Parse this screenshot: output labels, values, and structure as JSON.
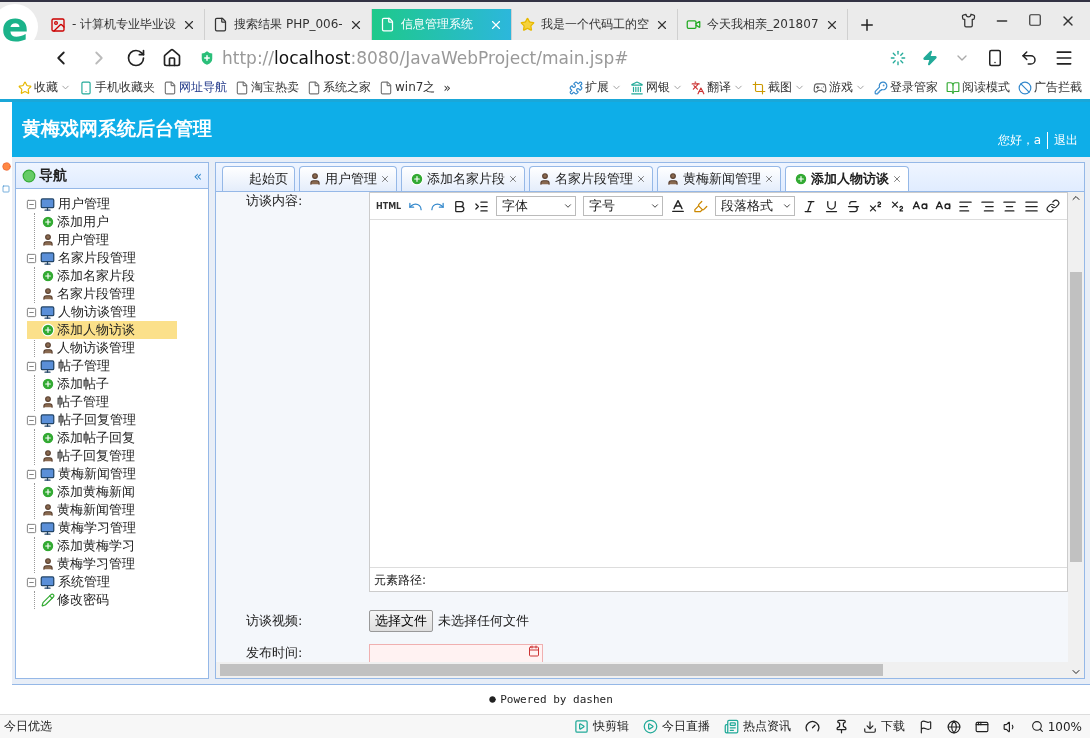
{
  "browser": {
    "logo": "e",
    "tabs": [
      {
        "title": "- 计算机专业毕业设",
        "kind": "image",
        "selected": false
      },
      {
        "title": "搜索结果 PHP_006-",
        "kind": "page",
        "selected": false
      },
      {
        "title": "信息管理系统",
        "kind": "page",
        "selected": true
      },
      {
        "title": "我是一个代码工的空",
        "kind": "star",
        "selected": false
      },
      {
        "title": "今天我相亲_201807",
        "kind": "video",
        "selected": false
      }
    ],
    "url": {
      "scheme": "http://",
      "host": "localhost",
      "path": ":8080/JavaWebProject/main.jsp#"
    },
    "bookmarks_left": [
      {
        "label": "收藏",
        "kind": "star",
        "menu": true
      },
      {
        "label": "手机收藏夹",
        "kind": "phone",
        "menu": false
      },
      {
        "label": "网址导航",
        "kind": "page",
        "menu": false
      },
      {
        "label": "淘宝热卖",
        "kind": "page",
        "menu": false
      },
      {
        "label": "系统之家",
        "kind": "page",
        "menu": false
      },
      {
        "label": "win7之",
        "kind": "page",
        "menu": false
      }
    ],
    "bookmarks_more": "»",
    "bookmarks_right": [
      {
        "label": "扩展",
        "kind": "apps",
        "menu": true
      },
      {
        "label": "网银",
        "kind": "bank",
        "menu": true
      },
      {
        "label": "翻译",
        "kind": "translate",
        "menu": true
      },
      {
        "label": "截图",
        "kind": "crop",
        "menu": true
      },
      {
        "label": "游戏",
        "kind": "game",
        "menu": true
      },
      {
        "label": "登录管家",
        "kind": "key",
        "menu": false
      },
      {
        "label": "阅读模式",
        "kind": "book",
        "menu": false
      },
      {
        "label": "广告拦截",
        "kind": "block",
        "menu": false
      }
    ]
  },
  "header": {
    "title": "黄梅戏网系统后台管理",
    "greeting": "您好，a",
    "logout": "退出"
  },
  "sidebar": {
    "title": "导航",
    "collapse": "«",
    "items": [
      {
        "label": "用户管理",
        "expanded": true,
        "children": [
          {
            "label": "添加用户",
            "kind": "add",
            "selected": false
          },
          {
            "label": "用户管理",
            "kind": "manage",
            "selected": false
          }
        ]
      },
      {
        "label": "名家片段管理",
        "expanded": true,
        "children": [
          {
            "label": "添加名家片段",
            "kind": "add",
            "selected": false
          },
          {
            "label": "名家片段管理",
            "kind": "manage",
            "selected": false
          }
        ]
      },
      {
        "label": "人物访谈管理",
        "expanded": true,
        "children": [
          {
            "label": "添加人物访谈",
            "kind": "add",
            "selected": true
          },
          {
            "label": "人物访谈管理",
            "kind": "manage",
            "selected": false
          }
        ]
      },
      {
        "label": "帖子管理",
        "expanded": true,
        "children": [
          {
            "label": "添加帖子",
            "kind": "add",
            "selected": false
          },
          {
            "label": "帖子管理",
            "kind": "manage",
            "selected": false
          }
        ]
      },
      {
        "label": "帖子回复管理",
        "expanded": true,
        "children": [
          {
            "label": "添加帖子回复",
            "kind": "add",
            "selected": false
          },
          {
            "label": "帖子回复管理",
            "kind": "manage",
            "selected": false
          }
        ]
      },
      {
        "label": "黄梅新闻管理",
        "expanded": true,
        "children": [
          {
            "label": "添加黄梅新闻",
            "kind": "add",
            "selected": false
          },
          {
            "label": "黄梅新闻管理",
            "kind": "manage",
            "selected": false
          }
        ]
      },
      {
        "label": "黄梅学习管理",
        "expanded": true,
        "children": [
          {
            "label": "添加黄梅学习",
            "kind": "add",
            "selected": false
          },
          {
            "label": "黄梅学习管理",
            "kind": "manage",
            "selected": false
          }
        ]
      },
      {
        "label": "系统管理",
        "expanded": true,
        "children": [
          {
            "label": "修改密码",
            "kind": "edit",
            "selected": false
          }
        ]
      }
    ]
  },
  "tabs": [
    {
      "label": "起始页",
      "kind": "home",
      "closable": false,
      "selected": false
    },
    {
      "label": "用户管理",
      "kind": "manage",
      "closable": true,
      "selected": false
    },
    {
      "label": "添加名家片段",
      "kind": "add",
      "closable": true,
      "selected": false
    },
    {
      "label": "名家片段管理",
      "kind": "manage",
      "closable": true,
      "selected": false
    },
    {
      "label": "黄梅新闻管理",
      "kind": "manage",
      "closable": true,
      "selected": false
    },
    {
      "label": "添加人物访谈",
      "kind": "add",
      "closable": true,
      "selected": true
    }
  ],
  "form": {
    "content_label": "访谈内容:",
    "editor": {
      "html_label": "HTML",
      "font": "字体",
      "size": "字号",
      "paragraph": "段落格式",
      "path_label": "元素路径:"
    },
    "video_label": "访谈视频:",
    "file_button": "选择文件",
    "file_status": "未选择任何文件",
    "date_label": "发布时间:"
  },
  "footer": "Powered by dashen",
  "status_bar": {
    "left": "今日优选",
    "items": [
      {
        "label": "快剪辑",
        "kind": "clip"
      },
      {
        "label": "今日直播",
        "kind": "live"
      },
      {
        "label": "热点资讯",
        "kind": "news"
      },
      {
        "label": "下载",
        "kind": "download"
      },
      {
        "label": "100%",
        "kind": "zoom"
      }
    ]
  }
}
